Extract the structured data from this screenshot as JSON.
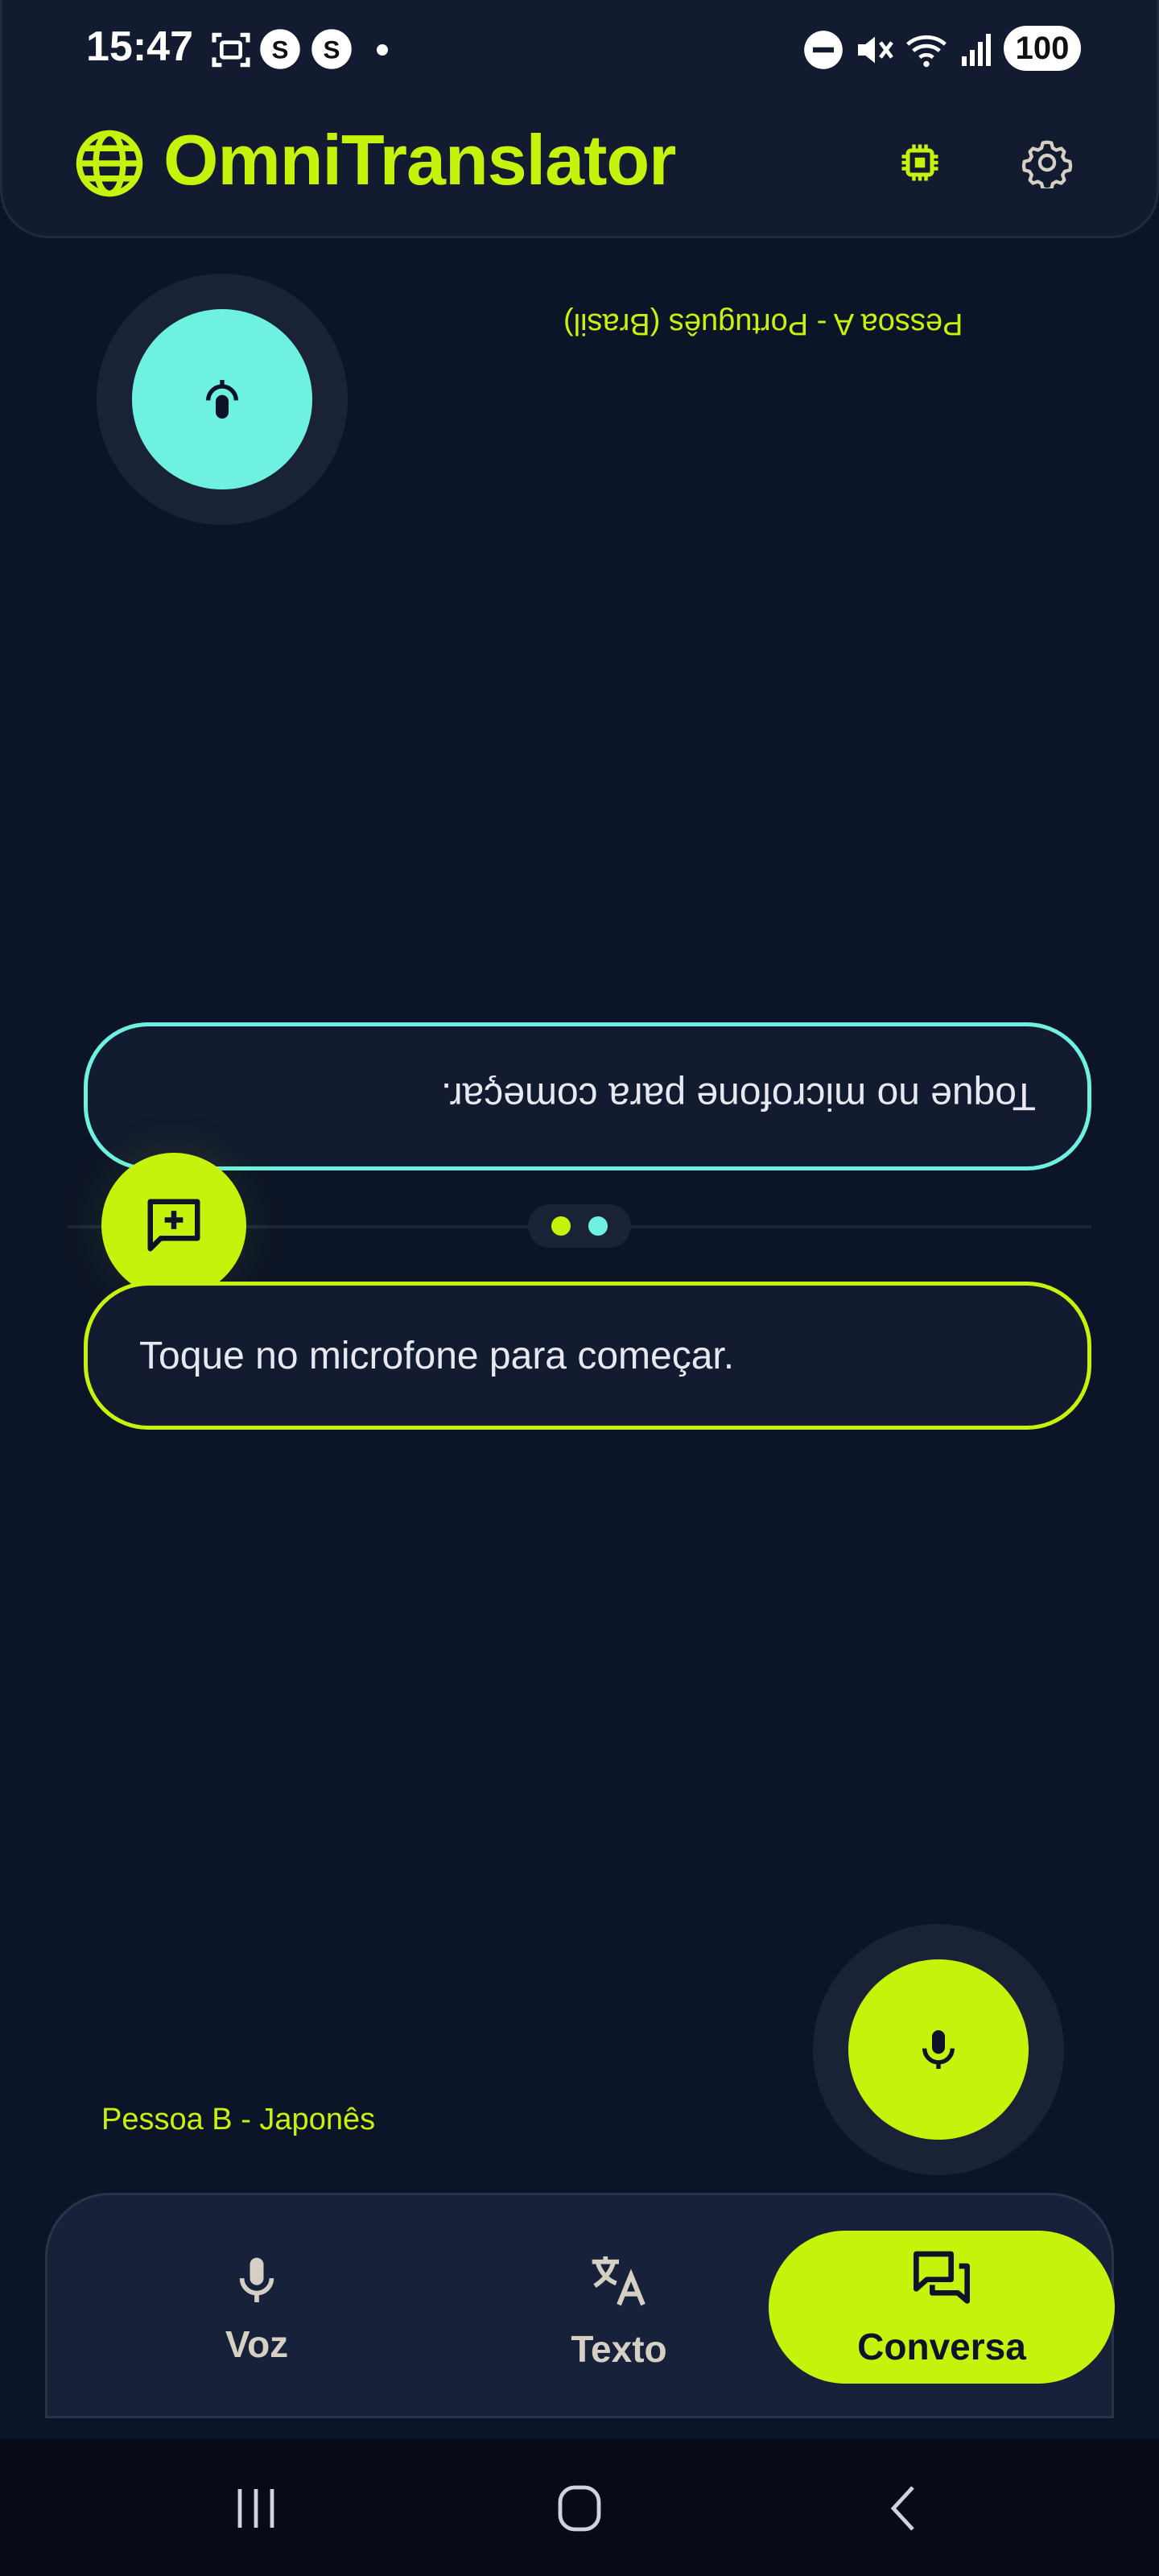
{
  "status_bar": {
    "time": "15:47",
    "battery": "100",
    "icons": [
      "screenshot-icon",
      "app-s-icon",
      "app-s-icon",
      "dot-icon",
      "dnd-icon",
      "mute-icon",
      "wifi-icon",
      "signal-icon"
    ]
  },
  "app_bar": {
    "title": "OmniTranslator",
    "icons": [
      "globe-icon",
      "chip-icon",
      "settings-icon"
    ]
  },
  "conversation": {
    "person_a": {
      "label": "Pessoa A - Português (Brasil)",
      "bubble_text": "Toque no microfone para começar."
    },
    "person_b": {
      "label": "Pessoa B - Japonês",
      "bubble_text": "Toque no microfone para começar."
    }
  },
  "bottom_nav": {
    "items": [
      {
        "label": "Voz",
        "icon": "mic-icon",
        "active": false
      },
      {
        "label": "Texto",
        "icon": "translate-icon",
        "active": false
      },
      {
        "label": "Conversa",
        "icon": "chat-icon",
        "active": true
      }
    ]
  },
  "colors": {
    "accent": "#c6f30b",
    "accent_secondary": "#6ef1e0",
    "background": "#0c1427",
    "surface": "#121b2f"
  }
}
